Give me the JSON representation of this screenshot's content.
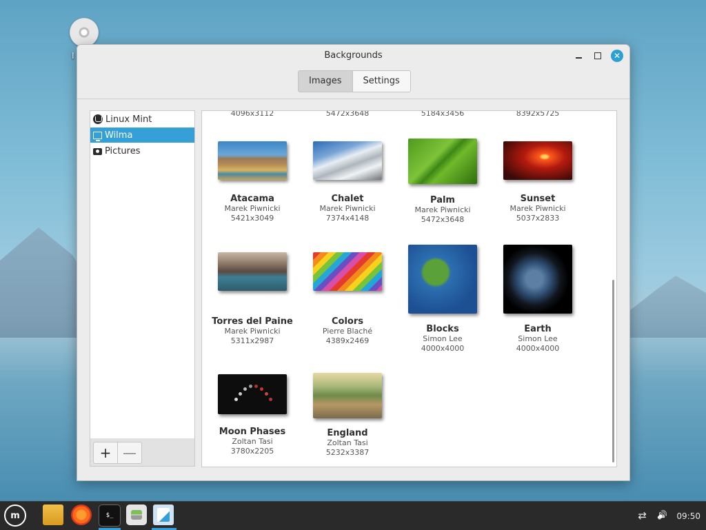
{
  "desktop": {
    "icon_label": "I"
  },
  "window": {
    "title": "Backgrounds",
    "tabs": [
      {
        "label": "Images",
        "active": true
      },
      {
        "label": "Settings",
        "active": false
      }
    ]
  },
  "sidebar": {
    "items": [
      {
        "label": "Linux Mint",
        "icon": "mint-logo-icon",
        "selected": false
      },
      {
        "label": "Wilma",
        "icon": "monitor-icon",
        "selected": true
      },
      {
        "label": "Pictures",
        "icon": "camera-icon",
        "selected": false
      }
    ],
    "add_label": "+",
    "remove_label": "—"
  },
  "grid": {
    "top_partial_sizes": [
      "4096x3112",
      "5472x3648",
      "5184x3456",
      "8392x5725"
    ],
    "items": [
      {
        "name": "Atacama",
        "author": "Marek Piwnicki",
        "size": "5421x3049"
      },
      {
        "name": "Chalet",
        "author": "Marek Piwnicki",
        "size": "7374x4148"
      },
      {
        "name": "Palm",
        "author": "Marek Piwnicki",
        "size": "5472x3648"
      },
      {
        "name": "Sunset",
        "author": "Marek Piwnicki",
        "size": "5037x2833"
      },
      {
        "name": "Torres del Paine",
        "author": "Marek Piwnicki",
        "size": "5311x2987"
      },
      {
        "name": "Colors",
        "author": "Pierre Blaché",
        "size": "4389x2469"
      },
      {
        "name": "Blocks",
        "author": "Simon Lee",
        "size": "4000x4000"
      },
      {
        "name": "Earth",
        "author": "Simon Lee",
        "size": "4000x4000"
      },
      {
        "name": "Moon Phases",
        "author": "Zoltan Tasi",
        "size": "3780x2205"
      },
      {
        "name": "England",
        "author": "Zoltan Tasi",
        "size": "5232x3387"
      }
    ]
  },
  "taskbar": {
    "terminal_glyph": "$_",
    "clock": "09:50",
    "accent": "#35a0d8"
  }
}
